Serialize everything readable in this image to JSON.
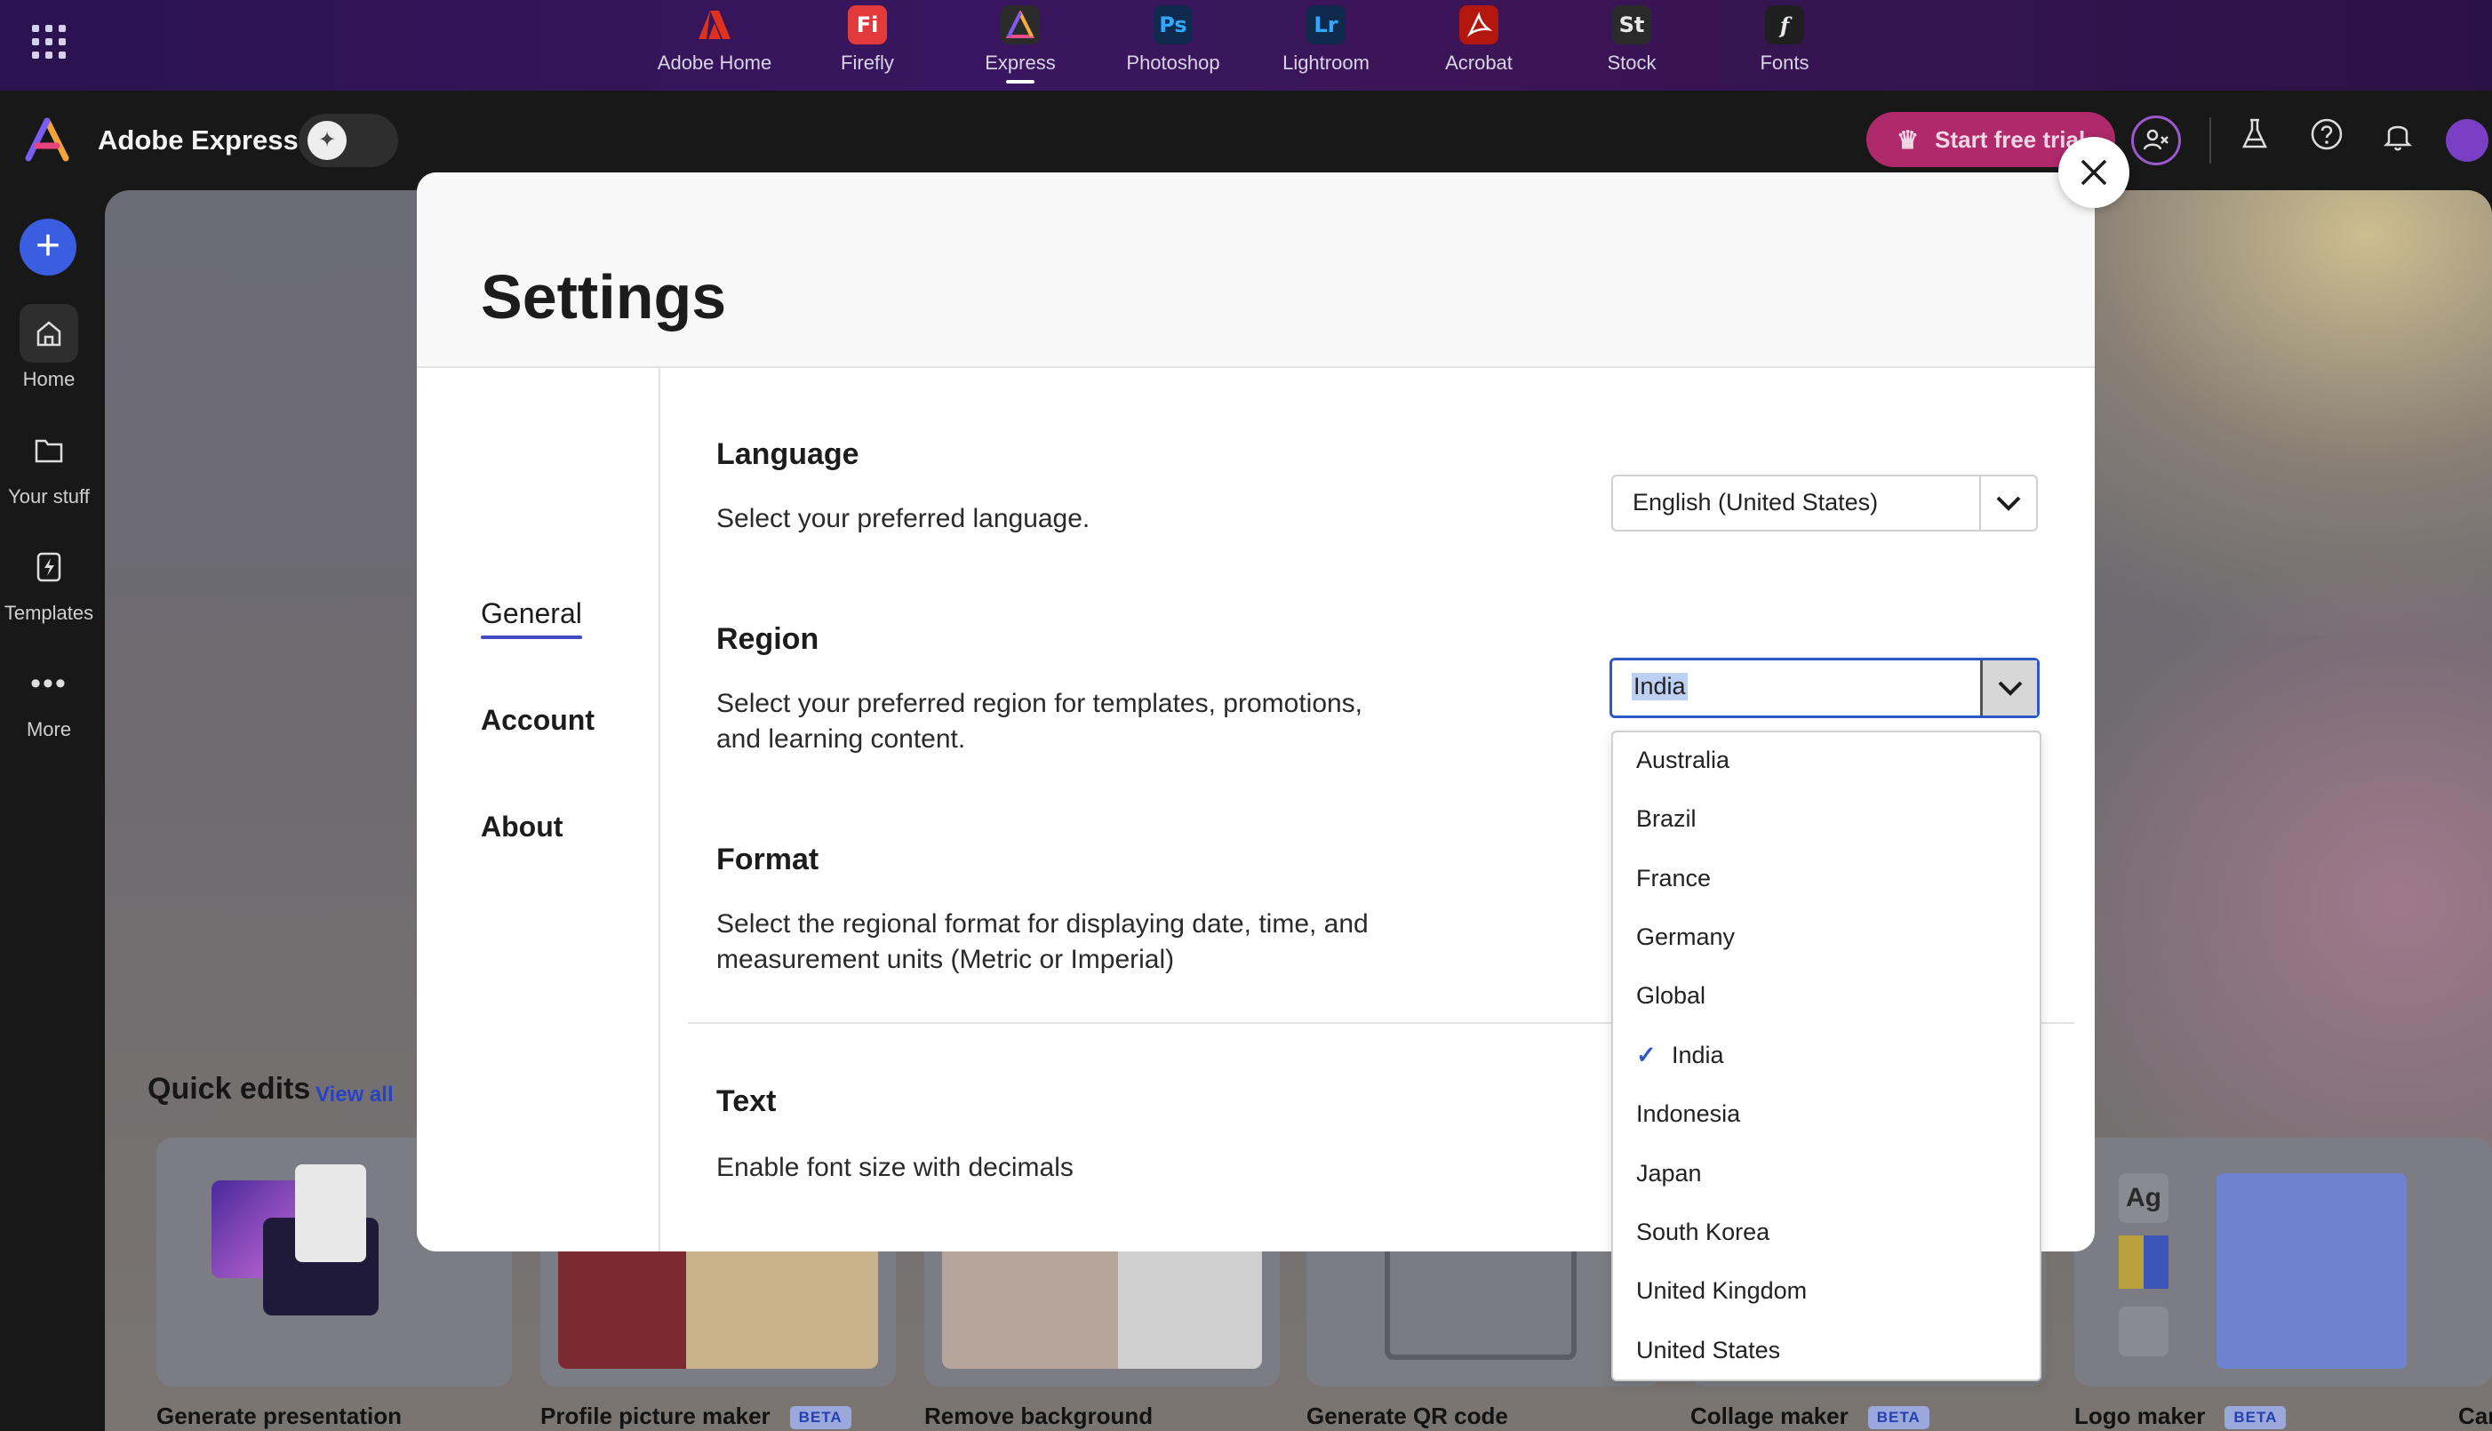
{
  "topbar": {
    "apps": [
      {
        "label": "Adobe Home",
        "short": "A",
        "color": "#e0301e"
      },
      {
        "label": "Firefly",
        "short": "Fi",
        "color": "#e23a3a"
      },
      {
        "label": "Express",
        "short": "A",
        "color": "#2b2b2b"
      },
      {
        "label": "Photoshop",
        "short": "Ps",
        "color": "#0f2a4c"
      },
      {
        "label": "Lightroom",
        "short": "Lr",
        "color": "#0f2a4c"
      },
      {
        "label": "Acrobat",
        "short": "A",
        "color": "#b3170e"
      },
      {
        "label": "Stock",
        "short": "St",
        "color": "#2a2a2a"
      },
      {
        "label": "Fonts",
        "short": "f",
        "color": "#1f1f1f"
      }
    ]
  },
  "header": {
    "brand": "Adobe Express",
    "trial_label": "Start free trial"
  },
  "rail": {
    "home": "Home",
    "your_stuff": "Your stuff",
    "templates": "Templates",
    "more": "More"
  },
  "background": {
    "quick_edits": "Quick edits",
    "view_all": "View all",
    "beta": "BETA",
    "cards": [
      "Generate presentation",
      "Profile picture maker",
      "Remove background",
      "Generate QR code",
      "Collage maker",
      "Logo maker",
      "Car"
    ],
    "logo_card_glyph": "Ag"
  },
  "settings": {
    "title": "Settings",
    "nav": [
      "General",
      "Account",
      "About"
    ],
    "language": {
      "title": "Language",
      "desc": "Select your preferred language.",
      "value": "English (United States)"
    },
    "region": {
      "title": "Region",
      "desc": "Select your preferred region for templates, promotions, and learning content.",
      "value": "India"
    },
    "format": {
      "title": "Format",
      "desc": "Select the regional format for displaying date, time, and measurement units (Metric or Imperial)"
    },
    "text": {
      "title": "Text",
      "desc": "Enable font size with decimals"
    },
    "region_options": [
      "Australia",
      "Brazil",
      "France",
      "Germany",
      "Global",
      "India",
      "Indonesia",
      "Japan",
      "South Korea",
      "United Kingdom",
      "United States"
    ],
    "selected_region": "India"
  },
  "colors": {
    "accent": "#3f4cc6",
    "focus": "#2f57c6",
    "trial": "#b02a6b"
  }
}
